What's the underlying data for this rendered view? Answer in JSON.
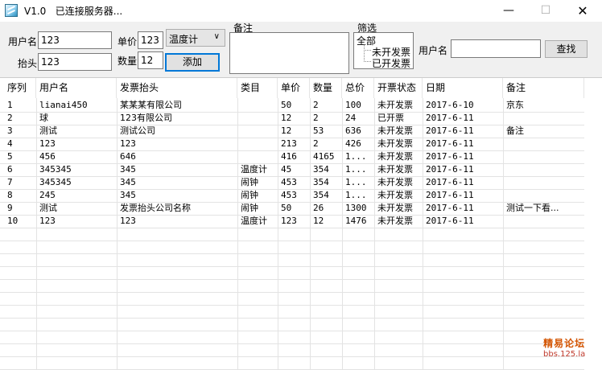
{
  "window": {
    "version": "V1.0",
    "status": "已连接服务器...",
    "minimize": "—",
    "maximize": "☐",
    "close": "✕"
  },
  "form": {
    "username_label": "用户名",
    "username_value": "123",
    "header_label": "抬头",
    "header_value": "123",
    "price_label": "单价",
    "price_value": "123",
    "qty_label": "数量",
    "qty_value": "12",
    "category_value": "温度计",
    "add_button": "添加",
    "remark_label": "备注",
    "remark_value": ""
  },
  "filter": {
    "label": "筛选",
    "all": "全部",
    "unbilled": "未开发票",
    "billed": "已开发票",
    "search_username_label": "用户名",
    "search_username_value": "",
    "search_button": "查找"
  },
  "table": {
    "columns": [
      "序列",
      "用户名",
      "发票抬头",
      "类目",
      "单价",
      "数量",
      "总价",
      "开票状态",
      "日期",
      "备注"
    ],
    "rows": [
      [
        "1",
        "lianai450",
        "某某某有限公司",
        "",
        "50",
        "2",
        "100",
        "未开发票",
        "2017-6-10",
        "京东"
      ],
      [
        "2",
        "球",
        "123有限公司",
        "",
        "12",
        "2",
        "24",
        "已开票",
        "2017-6-11",
        ""
      ],
      [
        "3",
        "测试",
        "测试公司",
        "",
        "12",
        "53",
        "636",
        "未开发票",
        "2017-6-11",
        "备注"
      ],
      [
        "4",
        "123",
        "123",
        "",
        "213",
        "2",
        "426",
        "未开发票",
        "2017-6-11",
        ""
      ],
      [
        "5",
        "456",
        "646",
        "",
        "416",
        "4165",
        "1...",
        "未开发票",
        "2017-6-11",
        ""
      ],
      [
        "6",
        "345345",
        "345",
        "温度计",
        "45",
        "354",
        "1...",
        "未开发票",
        "2017-6-11",
        ""
      ],
      [
        "7",
        "345345",
        "345",
        "闹钟",
        "453",
        "354",
        "1...",
        "未开发票",
        "2017-6-11",
        ""
      ],
      [
        "8",
        "245",
        "345",
        "闹钟",
        "453",
        "354",
        "1...",
        "未开发票",
        "2017-6-11",
        ""
      ],
      [
        "9",
        "测试",
        "发票抬头公司名称",
        "闹钟",
        "50",
        "26",
        "1300",
        "未开发票",
        "2017-6-11",
        "测试一下看..."
      ],
      [
        "10",
        "123",
        "123",
        "温度计",
        "123",
        "12",
        "1476",
        "未开发票",
        "2017-6-11",
        ""
      ]
    ]
  },
  "watermark": {
    "line1": "精易论坛",
    "line2": "bbs.125.la"
  }
}
